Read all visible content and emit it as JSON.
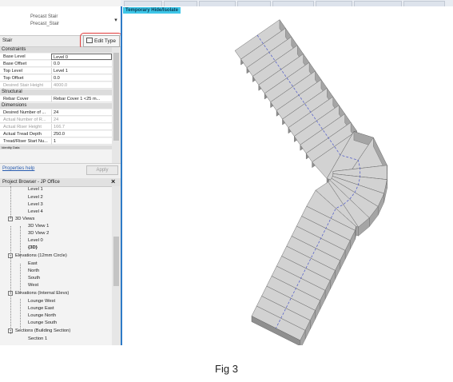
{
  "type_selector": {
    "line1": "Precast Stair",
    "line2": "Precast_Stair"
  },
  "selector": {
    "label": "Stair",
    "edit_type": "Edit Type"
  },
  "properties": {
    "categories": [
      "Constraints",
      "Structural",
      "Dimensions",
      "Identity Data"
    ],
    "rows": [
      {
        "k": "Base Level",
        "v": "Level 0"
      },
      {
        "k": "Base Offset",
        "v": "0.0"
      },
      {
        "k": "Top Level",
        "v": "Level 1"
      },
      {
        "k": "Top Offset",
        "v": "0.0"
      },
      {
        "k": "Desired Stair Height",
        "v": "4000.0"
      },
      {
        "k": "Rebar Cover",
        "v": "Rebar Cover 1 <25 m..."
      },
      {
        "k": "Desired Number of ...",
        "v": "24"
      },
      {
        "k": "Actual Number of R...",
        "v": "24"
      },
      {
        "k": "Actual Riser Height",
        "v": "166.7"
      },
      {
        "k": "Actual Tread Depth",
        "v": "250.0"
      },
      {
        "k": "Tread/Riser Start Nu...",
        "v": "1"
      }
    ],
    "help_link": "Properties help",
    "apply": "Apply"
  },
  "project_browser": {
    "title": "Project Browser - JP Office",
    "items": [
      "Level 1",
      "Level 2",
      "Level 3",
      "Level 4",
      "3D Views",
      "3D View 1",
      "3D View 2",
      "Level 0",
      "{3D}",
      "Elevations (12mm Circle)",
      "East",
      "North",
      "South",
      "West",
      "Elevations (Internal Elevs)",
      "Lounge West",
      "Lounge East",
      "Lounge North",
      "Lounge South",
      "Sections (Building Section)",
      "Section 1"
    ]
  },
  "view": {
    "temp_label": "Temporary Hide/Isolate"
  },
  "caption": "Fig 3",
  "colors": {
    "accent": "#2e7bc7",
    "highlight": "#e23a3a",
    "temp_label_bg": "#3ec6e8",
    "tread": "#d2d2d2",
    "riser": "#8f8f8f",
    "stringer": "#a5a5a5"
  }
}
